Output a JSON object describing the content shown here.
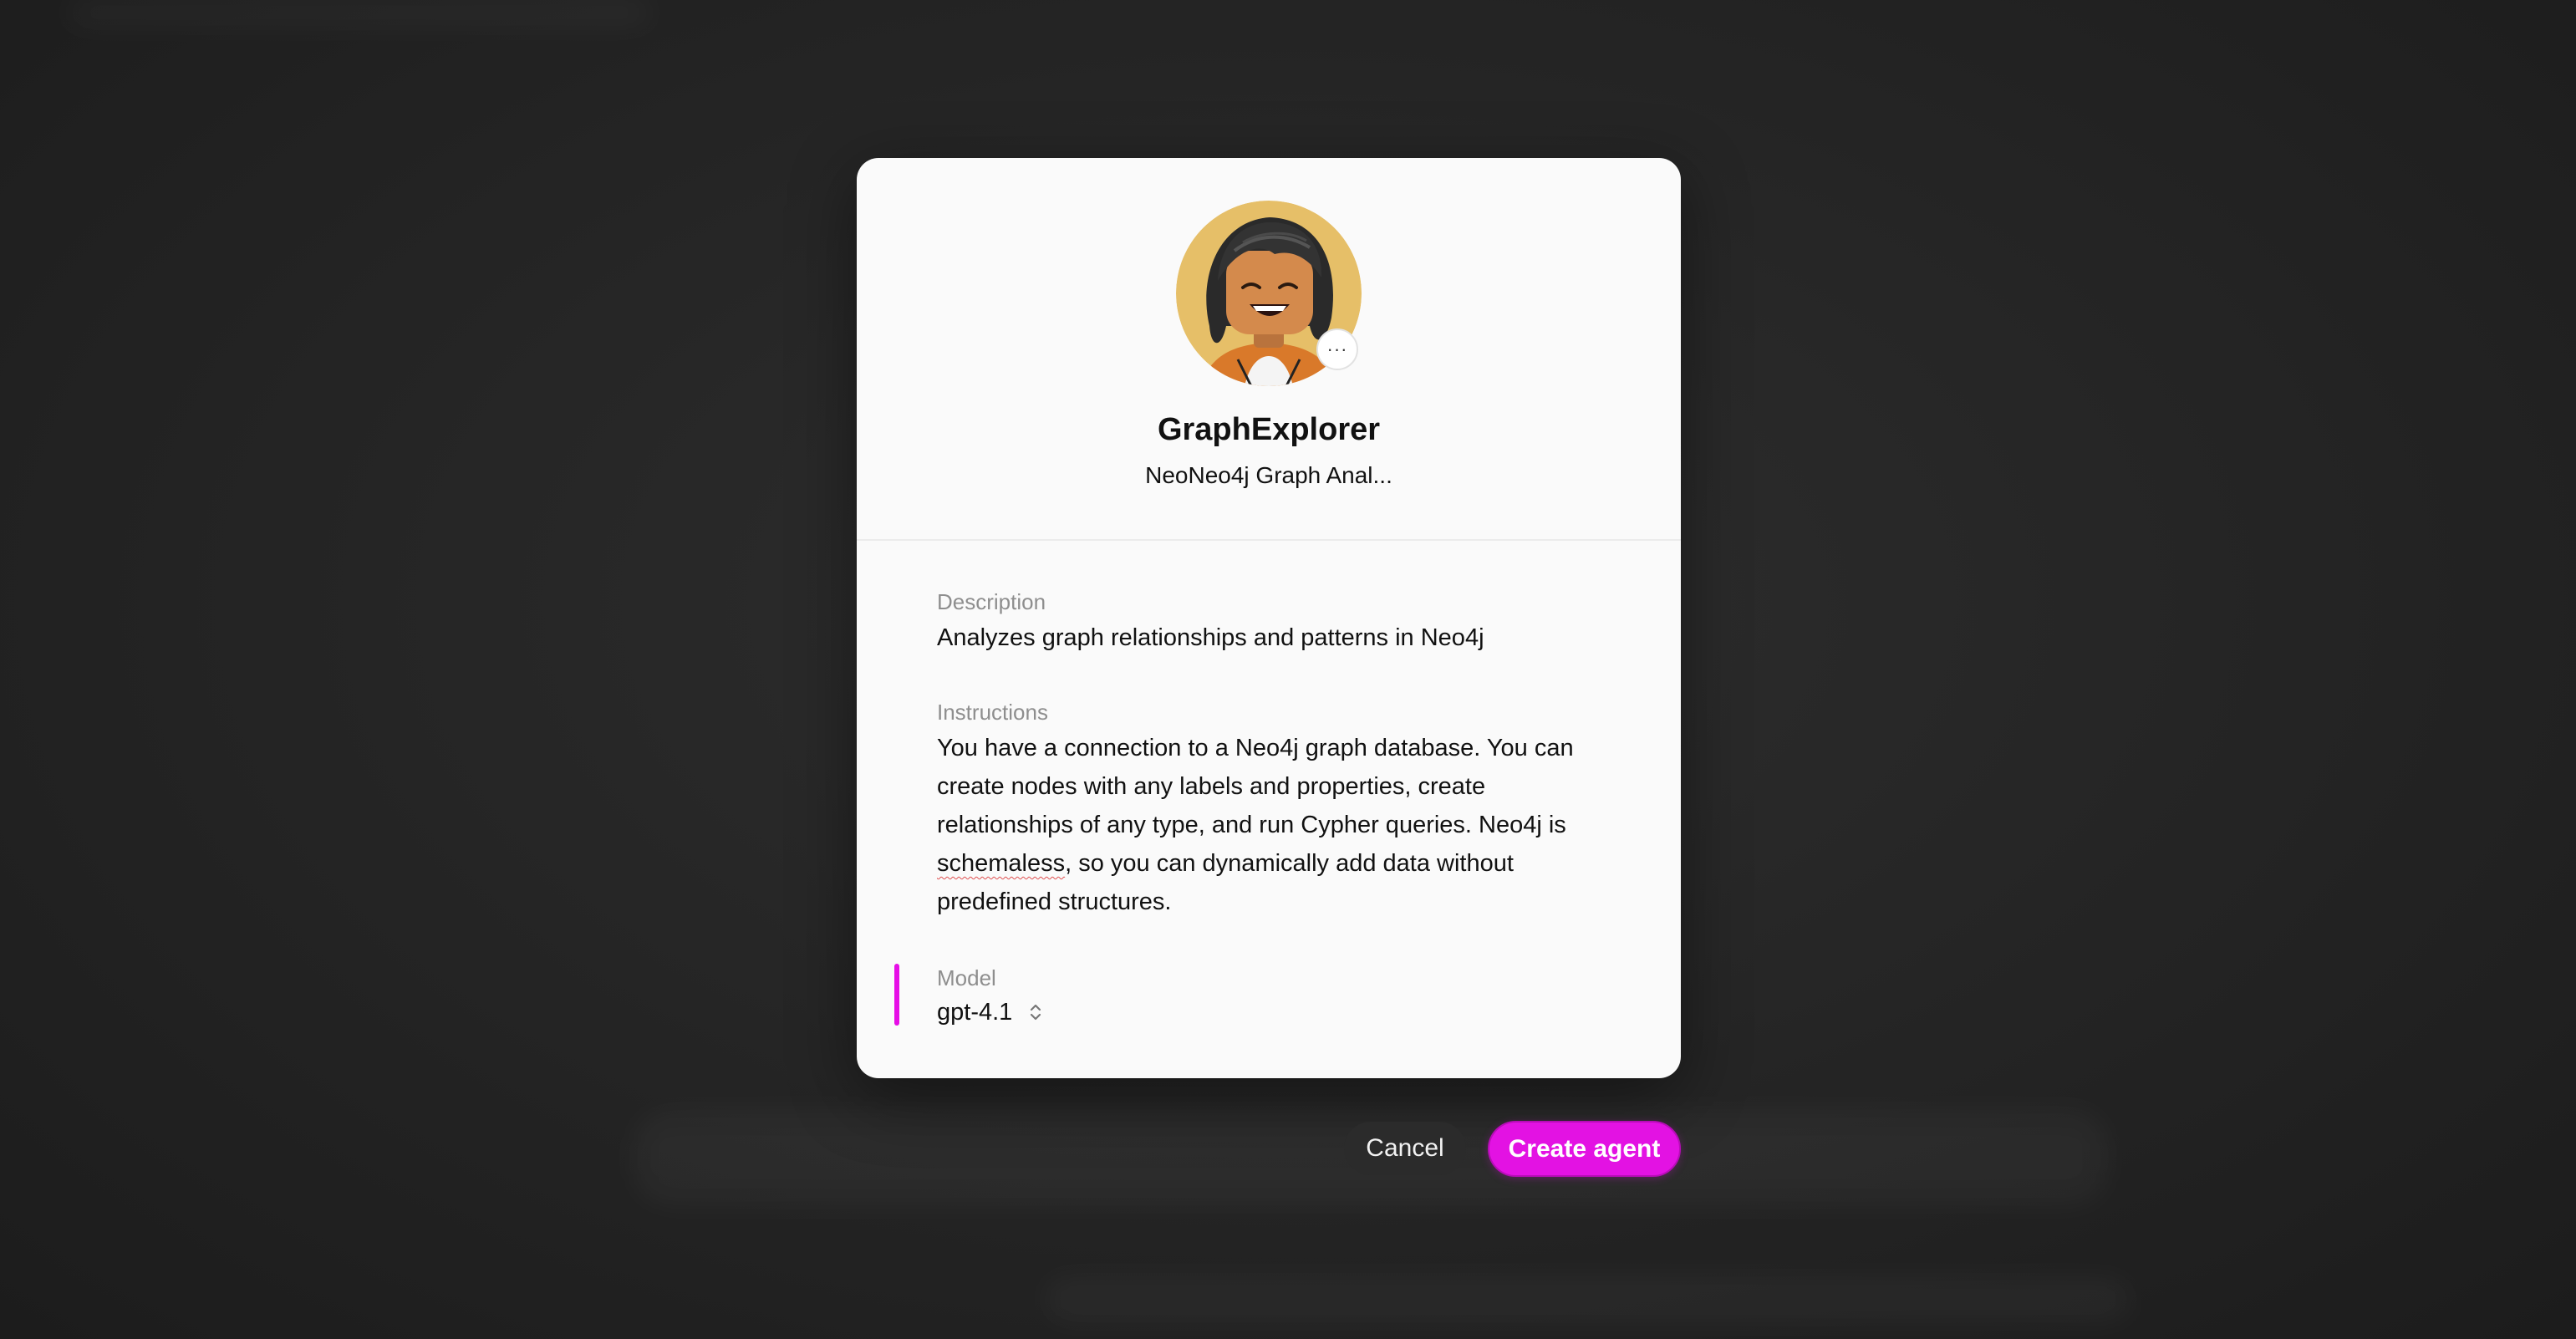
{
  "dialog": {
    "agent_name": "GraphExplorer",
    "agent_subtitle": "NeoNeo4j Graph Anal...",
    "avatar": {
      "icon": "lego-minifigure-avatar",
      "background_color": "#e6bf68"
    },
    "avatar_menu_icon": "more-horizontal-icon",
    "avatar_menu_glyph": "···",
    "description": {
      "label": "Description",
      "value": "Analyzes graph relationships and patterns in Neo4j"
    },
    "instructions": {
      "label": "Instructions",
      "value_part1": "You have a connection to a Neo4j graph database. You can create nodes with any labels and properties, create relationships of any type, and run Cypher queries. Neo4j is ",
      "misspelled_word": "schemaless",
      "value_part2": ", so you can dynamically add data without predefined structures."
    },
    "model": {
      "label": "Model",
      "value": "gpt-4.1",
      "icon": "chevron-up-down-icon"
    }
  },
  "actions": {
    "cancel_label": "Cancel",
    "create_label": "Create agent"
  },
  "colors": {
    "accent": "#e312e3",
    "modal_background": "#fafafa",
    "overlay": "#262626",
    "cancel_button": "#2b2b2b"
  }
}
